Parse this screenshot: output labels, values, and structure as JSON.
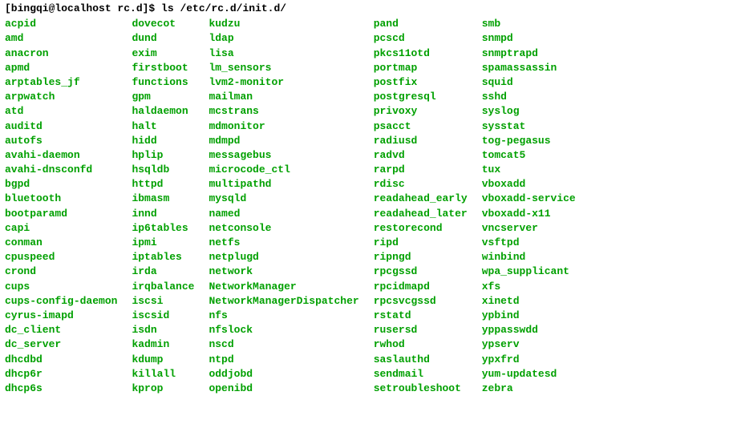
{
  "prompt": {
    "text": "[bingqi@localhost rc.d]$ ",
    "command": "ls /etc/rc.d/init.d/"
  },
  "columns": [
    [
      "acpid",
      "amd",
      "anacron",
      "apmd",
      "arptables_jf",
      "arpwatch",
      "atd",
      "auditd",
      "autofs",
      "avahi-daemon",
      "avahi-dnsconfd",
      "bgpd",
      "bluetooth",
      "bootparamd",
      "capi",
      "conman",
      "cpuspeed",
      "crond",
      "cups",
      "cups-config-daemon",
      "cyrus-imapd",
      "dc_client",
      "dc_server",
      "dhcdbd",
      "dhcp6r",
      "dhcp6s"
    ],
    [
      "dovecot",
      "dund",
      "exim",
      "firstboot",
      "functions",
      "gpm",
      "haldaemon",
      "halt",
      "hidd",
      "hplip",
      "hsqldb",
      "httpd",
      "ibmasm",
      "innd",
      "ip6tables",
      "ipmi",
      "iptables",
      "irda",
      "irqbalance",
      "iscsi",
      "iscsid",
      "isdn",
      "kadmin",
      "kdump",
      "killall",
      "kprop"
    ],
    [
      "kudzu",
      "ldap",
      "lisa",
      "lm_sensors",
      "lvm2-monitor",
      "mailman",
      "mcstrans",
      "mdmonitor",
      "mdmpd",
      "messagebus",
      "microcode_ctl",
      "multipathd",
      "mysqld",
      "named",
      "netconsole",
      "netfs",
      "netplugd",
      "network",
      "NetworkManager",
      "NetworkManagerDispatcher",
      "nfs",
      "nfslock",
      "nscd",
      "ntpd",
      "oddjobd",
      "openibd"
    ],
    [
      "pand",
      "pcscd",
      "pkcs11otd",
      "portmap",
      "postfix",
      "postgresql",
      "privoxy",
      "psacct",
      "radiusd",
      "radvd",
      "rarpd",
      "rdisc",
      "readahead_early",
      "readahead_later",
      "restorecond",
      "ripd",
      "ripngd",
      "rpcgssd",
      "rpcidmapd",
      "rpcsvcgssd",
      "rstatd",
      "rusersd",
      "rwhod",
      "saslauthd",
      "sendmail",
      "setroubleshoot"
    ],
    [
      "smb",
      "snmpd",
      "snmptrapd",
      "spamassassin",
      "squid",
      "sshd",
      "syslog",
      "sysstat",
      "tog-pegasus",
      "tomcat5",
      "tux",
      "vboxadd",
      "vboxadd-service",
      "vboxadd-x11",
      "vncserver",
      "vsftpd",
      "winbind",
      "wpa_supplicant",
      "xfs",
      "xinetd",
      "ypbind",
      "yppasswdd",
      "ypserv",
      "ypxfrd",
      "yum-updatesd",
      "zebra"
    ]
  ]
}
